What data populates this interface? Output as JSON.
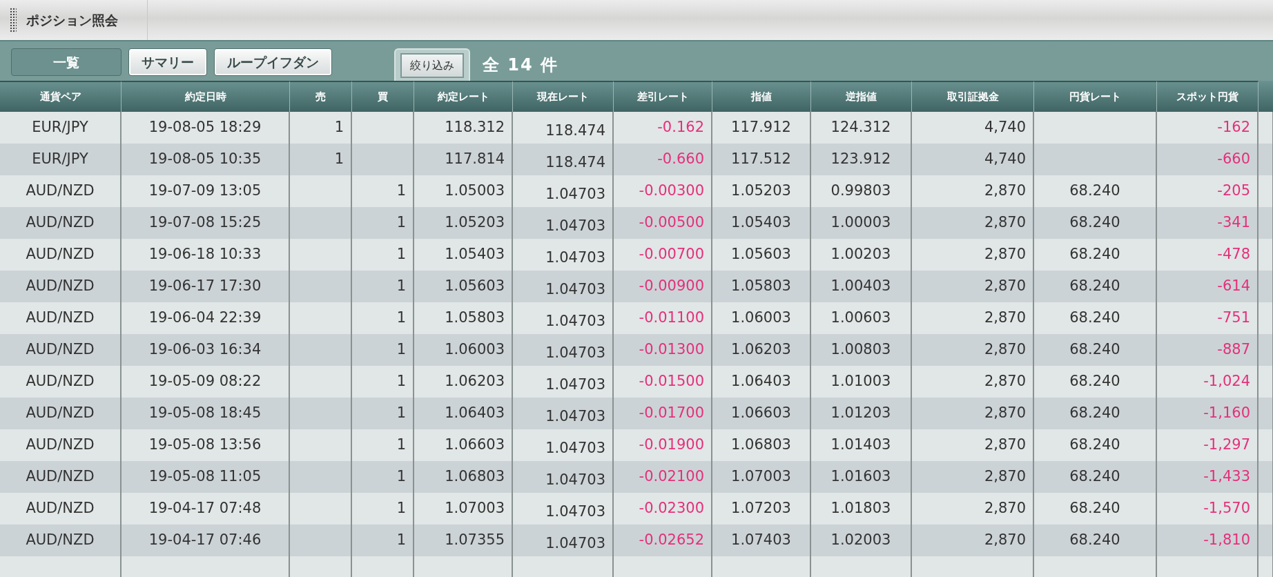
{
  "window": {
    "title": "ポジション照会"
  },
  "tabs": [
    {
      "label": "一覧",
      "selected": true
    },
    {
      "label": "サマリー",
      "selected": false
    },
    {
      "label": "ループイフダン",
      "selected": false
    }
  ],
  "filter_button": {
    "label": "絞り込み"
  },
  "count": "全 14 件",
  "table": {
    "columns": [
      {
        "label": "通貨ペア"
      },
      {
        "label": "約定日時"
      },
      {
        "label": "売"
      },
      {
        "label": "買"
      },
      {
        "label": "約定レート"
      },
      {
        "label": "現在レート"
      },
      {
        "label": "差引レート",
        "color": "#e4307c"
      },
      {
        "label": "指値"
      },
      {
        "label": "逆指値"
      },
      {
        "label": "取引証拠金"
      },
      {
        "label": "円貨レート"
      },
      {
        "label": "スポット円貨",
        "color": "#e4307c"
      }
    ],
    "rows": [
      [
        "EUR/JPY",
        "19-08-05 18:29",
        "1",
        "",
        "118.312",
        "118.474",
        "-0.162",
        "117.912",
        "124.312",
        "4,740",
        "",
        "-162"
      ],
      [
        "EUR/JPY",
        "19-08-05 10:35",
        "1",
        "",
        "117.814",
        "118.474",
        "-0.660",
        "117.512",
        "123.912",
        "4,740",
        "",
        "-660"
      ],
      [
        "AUD/NZD",
        "19-07-09 13:05",
        "",
        "1",
        "1.05003",
        "1.04703",
        "-0.00300",
        "1.05203",
        "0.99803",
        "2,870",
        "68.240",
        "-205"
      ],
      [
        "AUD/NZD",
        "19-07-08 15:25",
        "",
        "1",
        "1.05203",
        "1.04703",
        "-0.00500",
        "1.05403",
        "1.00003",
        "2,870",
        "68.240",
        "-341"
      ],
      [
        "AUD/NZD",
        "19-06-18 10:33",
        "",
        "1",
        "1.05403",
        "1.04703",
        "-0.00700",
        "1.05603",
        "1.00203",
        "2,870",
        "68.240",
        "-478"
      ],
      [
        "AUD/NZD",
        "19-06-17 17:30",
        "",
        "1",
        "1.05603",
        "1.04703",
        "-0.00900",
        "1.05803",
        "1.00403",
        "2,870",
        "68.240",
        "-614"
      ],
      [
        "AUD/NZD",
        "19-06-04 22:39",
        "",
        "1",
        "1.05803",
        "1.04703",
        "-0.01100",
        "1.06003",
        "1.00603",
        "2,870",
        "68.240",
        "-751"
      ],
      [
        "AUD/NZD",
        "19-06-03 16:34",
        "",
        "1",
        "1.06003",
        "1.04703",
        "-0.01300",
        "1.06203",
        "1.00803",
        "2,870",
        "68.240",
        "-887"
      ],
      [
        "AUD/NZD",
        "19-05-09 08:22",
        "",
        "1",
        "1.06203",
        "1.04703",
        "-0.01500",
        "1.06403",
        "1.01003",
        "2,870",
        "68.240",
        "-1,024"
      ],
      [
        "AUD/NZD",
        "19-05-08 18:45",
        "",
        "1",
        "1.06403",
        "1.04703",
        "-0.01700",
        "1.06603",
        "1.01203",
        "2,870",
        "68.240",
        "-1,160"
      ],
      [
        "AUD/NZD",
        "19-05-08 13:56",
        "",
        "1",
        "1.06603",
        "1.04703",
        "-0.01900",
        "1.06803",
        "1.01403",
        "2,870",
        "68.240",
        "-1,297"
      ],
      [
        "AUD/NZD",
        "19-05-08 11:05",
        "",
        "1",
        "1.06803",
        "1.04703",
        "-0.02100",
        "1.07003",
        "1.01603",
        "2,870",
        "68.240",
        "-1,433"
      ],
      [
        "AUD/NZD",
        "19-04-17 07:48",
        "",
        "1",
        "1.07003",
        "1.04703",
        "-0.02300",
        "1.07203",
        "1.01803",
        "2,870",
        "68.240",
        "-1,570"
      ],
      [
        "AUD/NZD",
        "19-04-17 07:46",
        "",
        "1",
        "1.07355",
        "1.04703",
        "-0.02652",
        "1.07403",
        "1.02003",
        "2,870",
        "68.240",
        "-1,810"
      ]
    ]
  }
}
